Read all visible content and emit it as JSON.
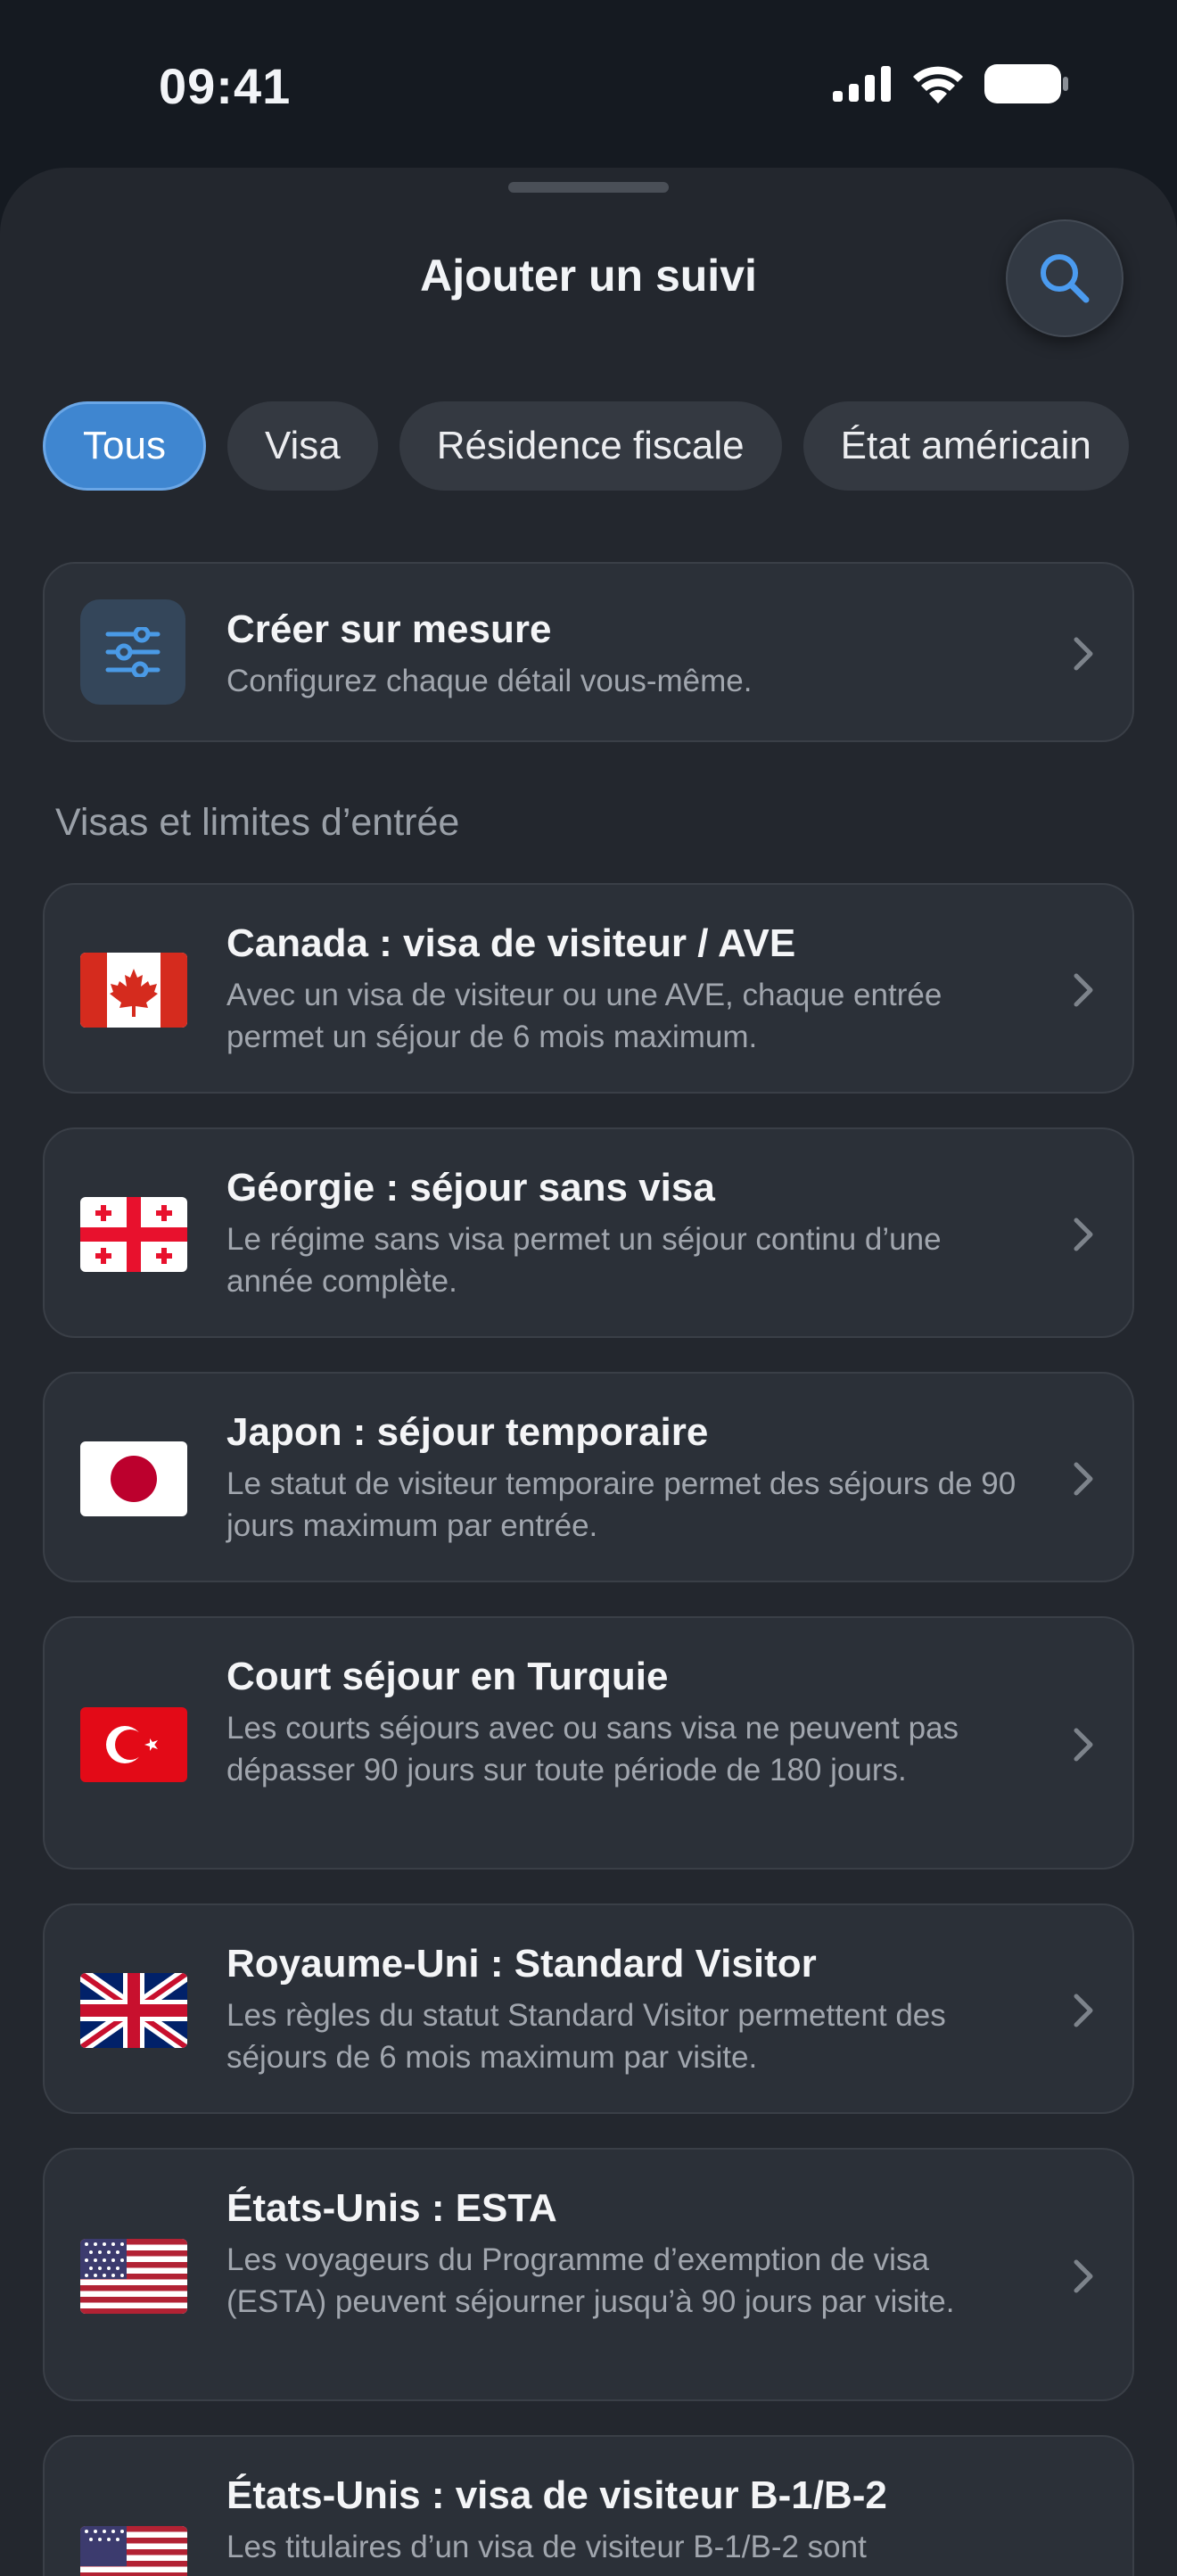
{
  "status": {
    "time": "09:41"
  },
  "sheet": {
    "title": "Ajouter un suivi"
  },
  "filters": [
    "Tous",
    "Visa",
    "Résidence fiscale",
    "État américain"
  ],
  "custom": {
    "title": "Créer sur mesure",
    "subtitle": "Configurez chaque détail vous-même."
  },
  "section_label": "Visas et limites d’entrée",
  "items": [
    {
      "flag": "canada-flag",
      "title": "Canada : visa de visiteur / AVE",
      "subtitle": "Avec un visa de visiteur ou une AVE, chaque entrée permet un séjour de 6 mois maximum."
    },
    {
      "flag": "georgia-flag",
      "title": "Géorgie : séjour sans visa",
      "subtitle": "Le régime sans visa permet un séjour continu d’une année complète."
    },
    {
      "flag": "japan-flag",
      "title": "Japon : séjour temporaire",
      "subtitle": "Le statut de visiteur temporaire permet des séjours de 90 jours maximum par entrée."
    },
    {
      "flag": "turkey-flag",
      "title": "Court séjour en Turquie",
      "subtitle": "Les courts séjours avec ou sans visa ne peuvent pas dépasser 90 jours sur toute période de 180 jours."
    },
    {
      "flag": "uk-flag",
      "title": "Royaume-Uni : Standard Visitor",
      "subtitle": "Les règles du statut Standard Visitor permettent des séjours de 6 mois maximum par visite."
    },
    {
      "flag": "usa-flag",
      "title": "États-Unis : ESTA",
      "subtitle": "Les voyageurs du Programme d’exemption de visa (ESTA) peuvent séjourner jusqu’à 90 jours par visite."
    },
    {
      "flag": "usa-flag",
      "title": "États-Unis : visa de visiteur B-1/B-2",
      "subtitle": "Les titulaires d’un visa de visiteur B-1/B-2 sont"
    }
  ],
  "colors": {
    "accent": "#3f86d0",
    "background": "#151a21",
    "sheet": "#23272e",
    "card": "#2b3038"
  }
}
